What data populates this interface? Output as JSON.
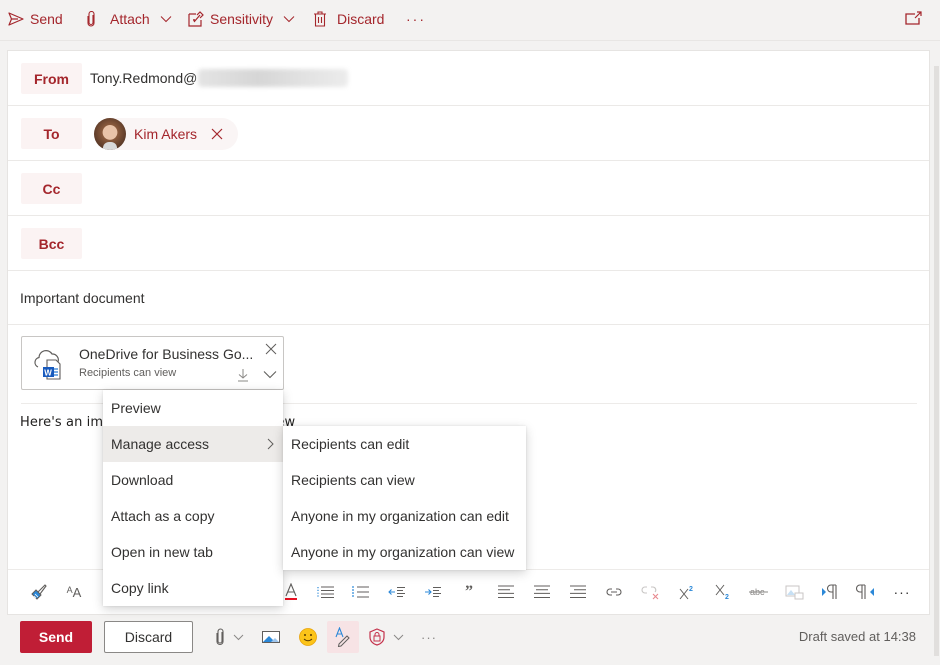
{
  "colors": {
    "accent": "#a4262c",
    "send_button": "#c01e36",
    "label_bg": "#fbf3f3",
    "toolbar_bg": "#f3f2f1",
    "icon_blue": "#2b88d8"
  },
  "toolbar": {
    "send_label": "Send",
    "attach_label": "Attach",
    "sensitivity_label": "Sensitivity",
    "discard_label": "Discard",
    "more_label": "···"
  },
  "header": {
    "from_label": "From",
    "from_value": "Tony.Redmond@",
    "to_label": "To",
    "to_recipients": [
      {
        "name": "Kim Akers"
      }
    ],
    "cc_label": "Cc",
    "bcc_label": "Bcc",
    "subject": "Important document"
  },
  "attachment": {
    "name": "OneDrive for Business Go...",
    "permission": "Recipients can view",
    "icon": "onedrive-word-icon"
  },
  "body": {
    "text_left": "Here's an im",
    "text_right": "to review"
  },
  "context_menu": {
    "items": [
      {
        "label": "Preview"
      },
      {
        "label": "Manage access",
        "has_submenu": true,
        "active": true
      },
      {
        "label": "Download"
      },
      {
        "label": "Attach as a copy"
      },
      {
        "label": "Open in new tab"
      },
      {
        "label": "Copy link"
      }
    ],
    "submenu": [
      {
        "label": "Recipients can edit"
      },
      {
        "label": "Recipients can view"
      },
      {
        "label": "Anyone in my organization can edit"
      },
      {
        "label": "Anyone in my organization can view"
      }
    ]
  },
  "format_toolbar": {
    "icons": [
      "format-painter-icon",
      "font-size-icon",
      "font-color-icon",
      "bullets-icon",
      "numbering-icon",
      "decrease-indent-icon",
      "increase-indent-icon",
      "quote-icon",
      "align-left-icon",
      "align-center-icon",
      "align-right-icon",
      "insert-link-icon",
      "remove-link-icon",
      "superscript-icon",
      "subscript-icon",
      "strikethrough-icon",
      "insert-image-icon",
      "ltr-icon",
      "rtl-icon",
      "more-icon"
    ],
    "more_label": "···"
  },
  "footer": {
    "send_label": "Send",
    "discard_label": "Discard",
    "more_label": "···",
    "draft_status": "Draft saved at 14:38"
  }
}
